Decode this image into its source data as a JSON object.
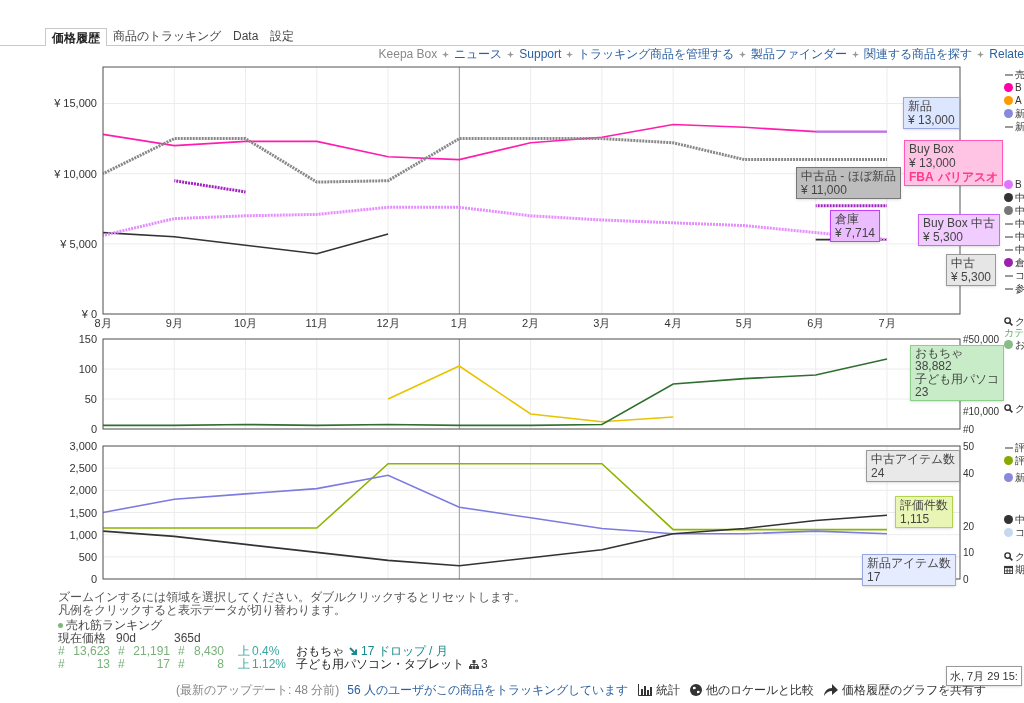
{
  "tabs": [
    {
      "label": "価格履歴",
      "selected": true
    },
    {
      "label": "商品のトラッキング",
      "selected": false
    },
    {
      "label": "Data",
      "selected": false
    },
    {
      "label": "設定",
      "selected": false
    }
  ],
  "links": [
    {
      "label": "Keepa Box",
      "kind": "plain"
    },
    {
      "label": "ニュース",
      "kind": "link"
    },
    {
      "label": "Support",
      "kind": "link"
    },
    {
      "label": "トラッキング商品を管理する",
      "kind": "link"
    },
    {
      "label": "製品ファインダー",
      "kind": "link"
    },
    {
      "label": "関連する商品を探す",
      "kind": "link"
    },
    {
      "label": "Relate",
      "kind": "link"
    }
  ],
  "price_chart": {
    "chart_data": {
      "type": "line",
      "categories": [
        "8月",
        "9月",
        "10月",
        "11月",
        "12月",
        "1月",
        "2月",
        "3月",
        "4月",
        "5月",
        "6月",
        "7月"
      ],
      "ylim": [
        0,
        17600
      ],
      "grid": true,
      "ref_lines": [
        {
          "axis": "x",
          "value": "1月"
        }
      ],
      "yticks": [
        {
          "value": 0,
          "label": "¥ 0"
        },
        {
          "value": 5000,
          "label": "¥ 5,000"
        },
        {
          "value": 10000,
          "label": "¥ 10,000"
        },
        {
          "value": 15000,
          "label": "¥ 15,000"
        }
      ],
      "series": [
        {
          "name": "中古品 - ほぼ新品",
          "color": "#888888",
          "line_style": "dashed",
          "values": [
            10000,
            12500,
            12500,
            9400,
            9500,
            12500,
            12500,
            12500,
            12200,
            11000,
            11000,
            11000
          ]
        },
        {
          "name": "Buy Box",
          "color": "#ff1cae",
          "values": [
            12800,
            12000,
            12300,
            12300,
            11200,
            11000,
            12200,
            12600,
            13500,
            13300,
            13000,
            13000
          ]
        },
        {
          "name": "新品",
          "color": "#8888ff",
          "values": [
            null,
            null,
            null,
            null,
            null,
            null,
            null,
            null,
            null,
            null,
            13000,
            13000
          ]
        },
        {
          "name": "Buy Box 中古",
          "color": "#e58cff",
          "line_style": "dashed",
          "values": [
            5600,
            6800,
            7000,
            7100,
            7600,
            7600,
            7000,
            6700,
            6500,
            6300,
            5800,
            5300
          ]
        },
        {
          "name": "倉庫",
          "color": "#a020c0",
          "line_style": "dashed",
          "values": [
            null,
            9500,
            8700,
            null,
            null,
            null,
            null,
            null,
            null,
            null,
            7714,
            7714
          ]
        },
        {
          "name": "中古",
          "color": "#333333",
          "values": [
            5800,
            5500,
            4900,
            4300,
            5700,
            null,
            null,
            null,
            null,
            null,
            5300,
            5300
          ]
        }
      ]
    }
  },
  "rank_chart": {
    "chart_data": {
      "type": "line",
      "ylim": [
        0,
        150
      ],
      "y2lim": [
        0,
        50000
      ],
      "grid": true,
      "yticks": [
        0,
        50,
        100,
        150
      ],
      "y2ticks": [
        {
          "value": 0,
          "label": "#0"
        },
        {
          "value": 10000,
          "label": "#10,000"
        },
        {
          "value": 50000,
          "label": "#50,000"
        }
      ],
      "series": [
        {
          "color": "#e8c400",
          "values": [
            null,
            null,
            null,
            null,
            50,
            105,
            25,
            12,
            20,
            null,
            null,
            null
          ]
        },
        {
          "name": "おもちゃ",
          "color": "#2f6f2f",
          "axis": "y2",
          "values": [
            2000,
            2000,
            2500,
            2000,
            2500,
            2000,
            2000,
            2500,
            25000,
            28000,
            30000,
            38882
          ]
        }
      ]
    }
  },
  "count_chart": {
    "chart_data": {
      "type": "line",
      "ylim": [
        0,
        3000
      ],
      "y2lim": [
        0,
        50
      ],
      "grid": true,
      "yticks": [
        {
          "value": 0,
          "label": "0"
        },
        {
          "value": 500,
          "label": "500"
        },
        {
          "value": 1000,
          "label": "1,000"
        },
        {
          "value": 1500,
          "label": "1,500"
        },
        {
          "value": 2000,
          "label": "2,000"
        },
        {
          "value": 2500,
          "label": "2,500"
        },
        {
          "value": 3000,
          "label": "3,000"
        }
      ],
      "y2ticks": [
        0,
        10,
        20,
        40,
        50
      ],
      "series": [
        {
          "name": "評価件数",
          "color": "#8cb400",
          "values": [
            1150,
            1150,
            1150,
            1150,
            2600,
            2600,
            2600,
            2600,
            1115,
            1115,
            1115,
            1115
          ]
        },
        {
          "name": "新品アイテム数",
          "color": "#7b7be0",
          "axis": "y2",
          "values": [
            25,
            30,
            32,
            34,
            39,
            27,
            23,
            19,
            17,
            17,
            18,
            17
          ]
        },
        {
          "name": "中古アイテム数",
          "color": "#333333",
          "axis": "y2",
          "values": [
            18,
            16,
            13,
            10,
            7,
            5,
            8,
            11,
            17,
            19,
            22,
            24
          ]
        }
      ]
    }
  },
  "tooltips": [
    {
      "kind": "new",
      "value": "¥ 13,000"
    },
    {
      "kind": "buybox",
      "value": "¥ 13,000",
      "badge": "FBA",
      "seller": "バリアスオ"
    },
    {
      "kind": "used_like_new",
      "value": "¥ 11,000"
    },
    {
      "kind": "warehouse",
      "value": "¥ 7,714"
    },
    {
      "kind": "buybox_used",
      "value": "¥ 5,300"
    },
    {
      "kind": "used",
      "value": "¥ 5,300"
    },
    {
      "kind": "rank",
      "value": "38,882",
      "extra_label": "子ども用パソコ",
      "extra_value": "23"
    },
    {
      "kind": "reviews",
      "value": "1,115"
    },
    {
      "kind": "used_count",
      "value": "24"
    },
    {
      "kind": "new_count",
      "value": "17"
    }
  ],
  "legend": [
    [
      {
        "kind": "line",
        "label": "売",
        "color": "#999999"
      },
      {
        "kind": "dot",
        "label": "B",
        "color": "#ff00aa"
      },
      {
        "kind": "dot",
        "label": "A",
        "color": "#ff9900"
      },
      {
        "kind": "dot",
        "label": "新",
        "color": "#8888dd"
      },
      {
        "kind": "line",
        "label": "新",
        "color": "#999999"
      },
      {
        "kind": "dot",
        "label": "B",
        "color": "#dd77ff"
      },
      {
        "kind": "dot",
        "label": "中",
        "color": "#333333"
      },
      {
        "kind": "dot",
        "label": "中",
        "color": "#777777"
      },
      {
        "kind": "line",
        "label": "中",
        "color": "#999999"
      },
      {
        "kind": "line",
        "label": "中",
        "color": "#999999"
      },
      {
        "kind": "line",
        "label": "中",
        "color": "#999999"
      },
      {
        "kind": "dot",
        "label": "倉",
        "color": "#9922aa"
      },
      {
        "kind": "line",
        "label": "コ",
        "color": "#999999"
      },
      {
        "kind": "line",
        "label": "参",
        "color": "#999999"
      }
    ],
    [
      {
        "kind": "search",
        "label": "ク"
      },
      {
        "kind": "heading",
        "label": "カテ"
      },
      {
        "kind": "dot",
        "label": "お",
        "color": "#88bb88"
      },
      {
        "kind": "search",
        "label": "ク"
      }
    ],
    [
      {
        "kind": "line",
        "label": "評",
        "color": "#999999"
      },
      {
        "kind": "dot",
        "label": "評",
        "color": "#88aa00"
      },
      {
        "kind": "dot",
        "label": "新",
        "color": "#8888dd"
      },
      {
        "kind": "dot",
        "label": "中",
        "color": "#333333"
      },
      {
        "kind": "dot",
        "label": "コ",
        "color": "#c8d8f0"
      },
      {
        "kind": "search",
        "label": "ク"
      },
      {
        "kind": "calendar",
        "label": "期"
      }
    ]
  ],
  "date_label": "水, 7月 29 15:",
  "hints": [
    "ズームインするには領域を選択してください。ダブルクリックするとリセットします。",
    "凡例をクリックすると表示データが切り替わります。"
  ],
  "ranking": {
    "title": "売れ筋ランキング",
    "headers": [
      "現在価格",
      "90d",
      "365d"
    ],
    "rows": [
      {
        "current": "13,623",
        "d90": "21,191",
        "d365": "8,430",
        "trend": "上",
        "change": "0.4%",
        "category": "おもちゃ",
        "kind": "drops",
        "extra": "17 ドロップ / 月"
      },
      {
        "current": "13",
        "d90": "17",
        "d365": "8",
        "trend": "上",
        "change": "1.12%",
        "category": "子ども用パソコン・タブレット",
        "kind": "tree",
        "extra": "3"
      }
    ],
    "hash": "#"
  },
  "footer": {
    "updated": "(最新のアップデート: 48 分前)",
    "tracking": "56 人のユーザがこの商品をトラッキングしています",
    "actions": [
      {
        "kind": "stats",
        "label": "統計"
      },
      {
        "kind": "globe",
        "label": "他のロケールと比較"
      },
      {
        "kind": "share",
        "label": "価格履歴のグラフを共有す"
      }
    ]
  }
}
